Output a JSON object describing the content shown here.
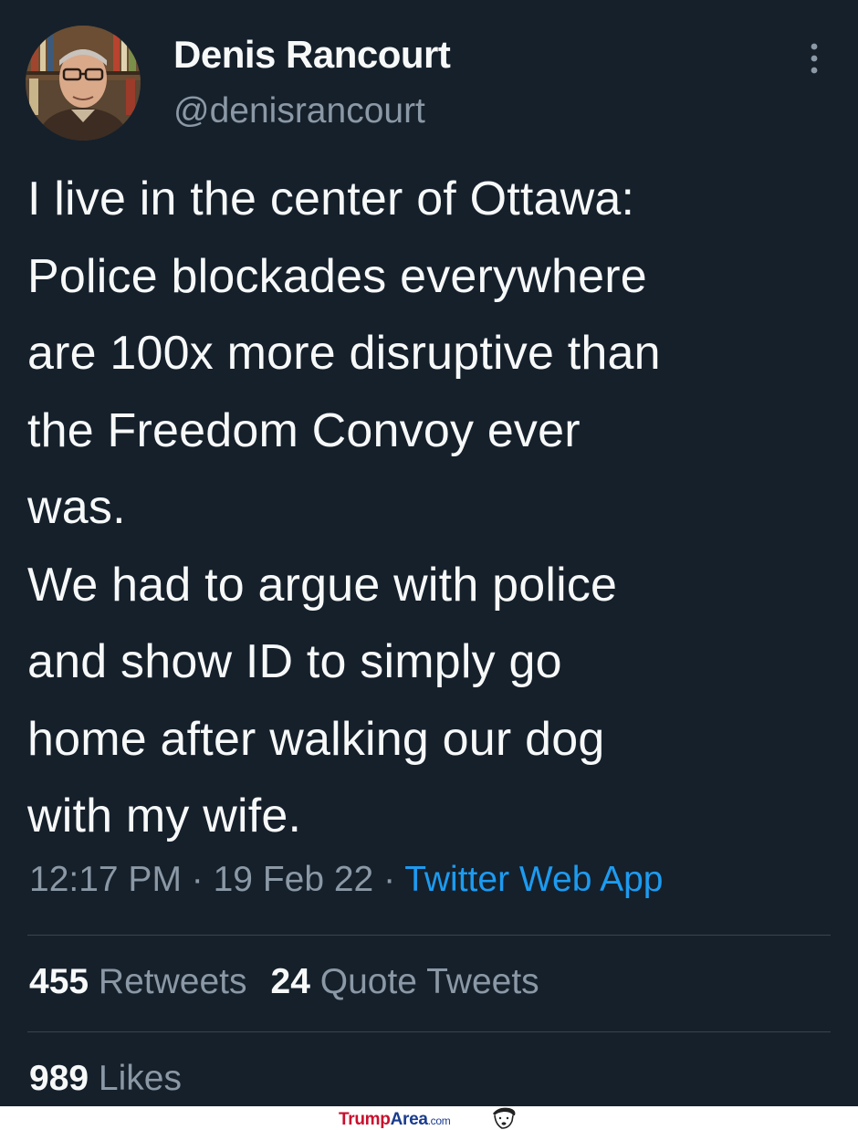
{
  "author": {
    "display_name": "Denis Rancourt",
    "handle": "@denisrancourt"
  },
  "tweet": {
    "lines": [
      "I live in the center of Ottawa:",
      "Police blockades everywhere",
      "are 100x more disruptive than",
      "the Freedom Convoy ever",
      "was.",
      "We had to argue with police",
      "and show ID to simply go",
      "home after walking our dog",
      "with my wife."
    ],
    "time": "12:17 PM",
    "separator": " · ",
    "date": "19 Feb 22",
    "source": "Twitter Web App"
  },
  "stats": {
    "retweets_count": "455",
    "retweets_label": "Retweets",
    "quotes_count": "24",
    "quotes_label": "Quote Tweets",
    "likes_count": "989",
    "likes_label": "Likes"
  },
  "watermark": {
    "part1": "Trump",
    "part2": "Area",
    "part3": ".com"
  },
  "icons": {
    "more": "more-vertical-icon",
    "avatar": "avatar"
  },
  "colors": {
    "background": "#15202b",
    "text": "#f7f9f9",
    "secondary": "#8b98a5",
    "link": "#1d9bf0",
    "divider": "#38444d"
  }
}
